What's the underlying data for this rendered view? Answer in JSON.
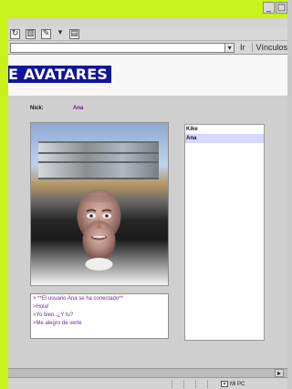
{
  "window": {
    "controls": [
      "_",
      "□",
      "×"
    ]
  },
  "toolbar": {
    "icons": [
      "forward-icon",
      "print-icon",
      "edit-icon",
      "dropdown-arrow-icon",
      "page-icon"
    ]
  },
  "address_bar": {
    "go_label": "Ir",
    "links_label": "Vínculos"
  },
  "page": {
    "title": "E AVATARES",
    "nick_label": "Nick:",
    "nick_value": "Ana"
  },
  "users": {
    "items": [
      {
        "name": "Kike",
        "selected": false
      },
      {
        "name": "Ana",
        "selected": true
      }
    ]
  },
  "chat": {
    "lines": [
      "> **El usuario Ana se ha conectado**",
      ">Hola!",
      ">Yo bien. ¿Y tu?",
      ">Me alegro de verte"
    ]
  },
  "status": {
    "zone_text": "Mi PC"
  },
  "colors": {
    "left_accent": "#c8f21a",
    "title_background": "#12159a",
    "title_text": "#ffffff",
    "nick_value": "#5d1a83",
    "chat_text": "#6b2a9c",
    "selected_user_background": "#d7d7ff"
  }
}
